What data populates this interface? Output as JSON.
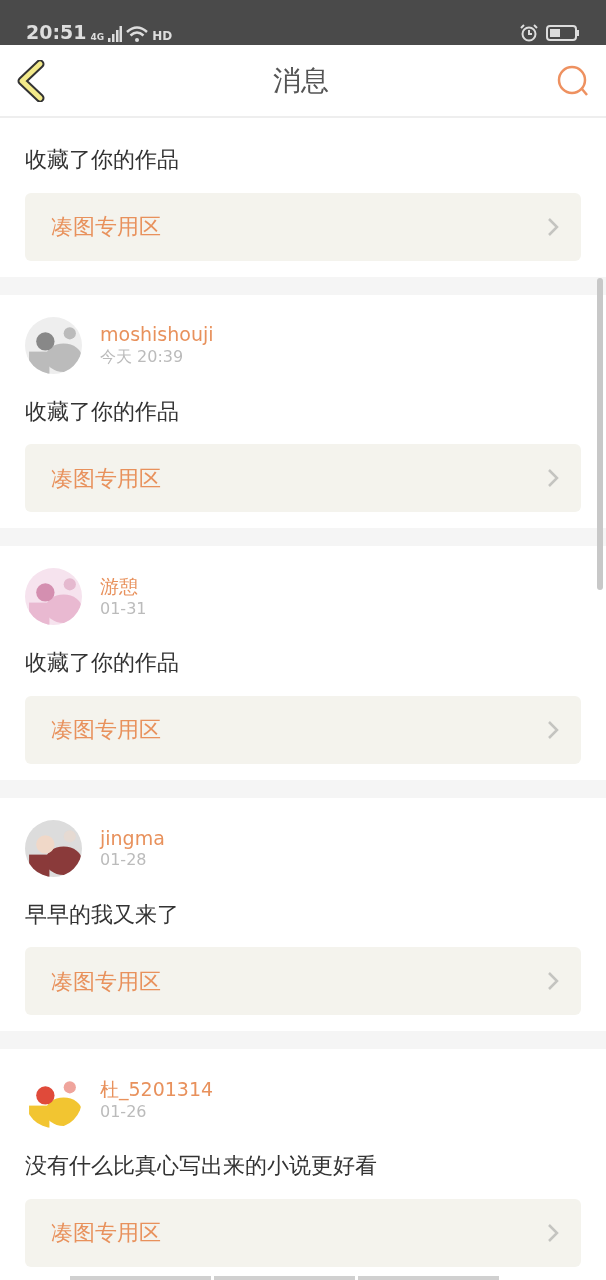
{
  "status_bar": {
    "time": "20:51",
    "network": "4G",
    "hd": "HD"
  },
  "header": {
    "title": "消息"
  },
  "messages": [
    {
      "kind": "cut",
      "message": "收藏了你的作品",
      "link": "凑图专用区"
    },
    {
      "kind": "full",
      "name": "moshishouji",
      "time": "今天 20:39",
      "message": "收藏了你的作品",
      "link": "凑图专用区"
    },
    {
      "kind": "full",
      "name": "游憩",
      "time": "01-31",
      "message": "收藏了你的作品",
      "link": "凑图专用区"
    },
    {
      "kind": "full",
      "name": "jingma",
      "time": "01-28",
      "message": "早早的我又来了",
      "link": "凑图专用区"
    },
    {
      "kind": "full",
      "name": "杜_5201314",
      "time": "01-26",
      "message": "没有什么比真心写出来的小说更好看",
      "link": "凑图专用区"
    }
  ]
}
